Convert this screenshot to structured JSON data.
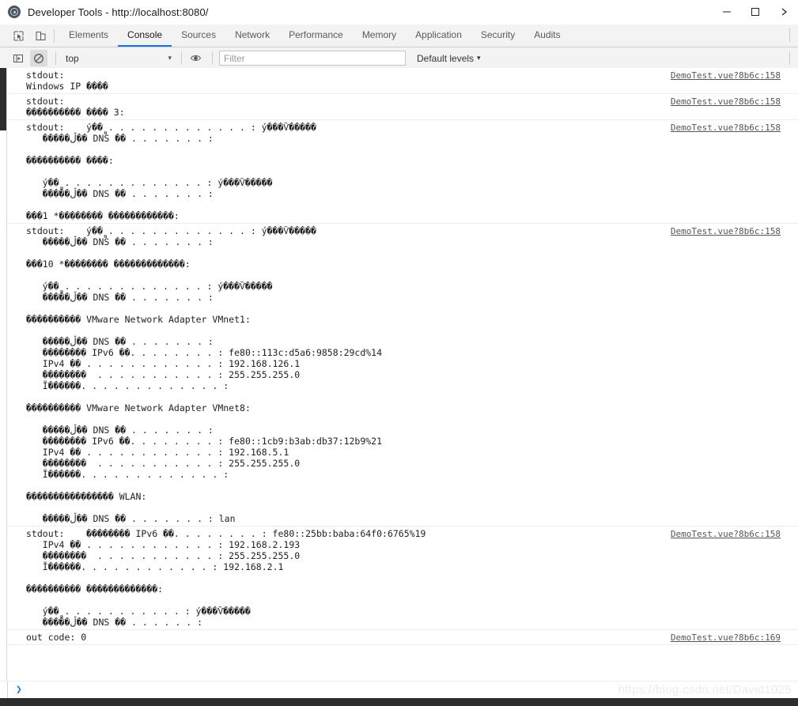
{
  "window": {
    "title": "Developer Tools - http://localhost:8080/",
    "logo_icon": "devtools-logo-icon",
    "controls": {
      "minimize": "minimize-icon",
      "maximize": "maximize-icon",
      "more": "more-chevron-icon"
    }
  },
  "tabstrip": {
    "inspect_icon": "inspect-element-icon",
    "device_icon": "device-toolbar-icon",
    "tabs": [
      {
        "label": "Elements",
        "active": false
      },
      {
        "label": "Console",
        "active": true
      },
      {
        "label": "Sources",
        "active": false
      },
      {
        "label": "Network",
        "active": false
      },
      {
        "label": "Performance",
        "active": false
      },
      {
        "label": "Memory",
        "active": false
      },
      {
        "label": "Application",
        "active": false
      },
      {
        "label": "Security",
        "active": false
      },
      {
        "label": "Audits",
        "active": false
      }
    ]
  },
  "console_toolbar": {
    "sidebar_toggle_icon": "console-sidebar-toggle-icon",
    "clear_icon": "clear-console-icon",
    "context_value": "top",
    "context_caret": "▾",
    "eye_icon": "live-expression-eye-icon",
    "filter_placeholder": "Filter",
    "filter_value": "",
    "levels_label": "Default levels",
    "levels_caret": "▾"
  },
  "console": {
    "messages": [
      {
        "text": "stdout:\nWindows IP ����",
        "source": "DemoTest.vue?8b6c:158"
      },
      {
        "text": "stdout:\n���������� ���� 3:",
        "source": "DemoTest.vue?8b6c:158"
      },
      {
        "text": "stdout:    ý��̻ . . . . . . . . . . . . . : ý���Ѷ�����\n   �����ڵ�� DNS ��׺ . . . . . . . :\n\n���������� ����:\n\n   ý��̻ . . . . . . . . . . . . . : ý���Ѷ�����\n   �����ڵ�� DNS ��׺ . . . . . . . :\n\n���1 *�������� ������������:",
        "source": "DemoTest.vue?8b6c:158"
      },
      {
        "text": "stdout:    ý��̻ . . . . . . . . . . . . . : ý���Ѷ�����\n   �����ڵ�� DNS ��׺ . . . . . . . :\n\n���10 *�������� �������������:\n\n   ý��̻ . . . . . . . . . . . . . : ý���Ѷ�����\n   �����ڵ�� DNS ��׺ . . . . . . . :\n\n���������� VMware Network Adapter VMnet1:\n\n   �����ڵ�� DNS ��׺ . . . . . . . :\n   �������� IPv6 ��. . . . . . . . : fe80::113c:d5a6:9858:29cd%14\n   IPv4 �� . . . . . . . . . . . . : 192.168.126.1\n   ��������  . . . . . . . . . . . : 255.255.255.0\n   Ĭ������. . . . . . . . . . . . . :\n\n���������� VMware Network Adapter VMnet8:\n\n   �����ڵ�� DNS ��׺ . . . . . . . :\n   �������� IPv6 ��. . . . . . . . : fe80::1cb9:b3ab:db37:12b9%21\n   IPv4 �� . . . . . . . . . . . . : 192.168.5.1\n   ��������  . . . . . . . . . . . : 255.255.255.0\n   Ĭ������. . . . . . . . . . . . . :\n\n���������������� WLAN:\n\n   �����ڵ�� DNS ��׺ . . . . . . . : lan",
        "source": "DemoTest.vue?8b6c:158"
      },
      {
        "text": "stdout:    �������� IPv6 ��. . . . . . . . : fe80::25bb:baba:64f0:6765%19\n   IPv4 �� . . . . . . . . . . . . : 192.168.2.193\n   ��������  . . . . . . . . . . . : 255.255.255.0\n   Ĭ������. . . . . . . . . . . . : 192.168.2.1\n\n���������� �������������:\n\n   ý��̻ . . . . . . . . . . . : ý���Ѷ�����\n   �����ڵ�� DNS ��׺ . . . . . . :",
        "source": "DemoTest.vue?8b6c:158"
      },
      {
        "text": "out code: 0",
        "source": "DemoTest.vue?8b6c:169"
      }
    ],
    "prompt_caret": "❯"
  },
  "watermark": "https://blog.csdn.net/David1025",
  "colors": {
    "accent": "#1a73e8",
    "toolbar_bg": "#f3f3f3",
    "border": "#cdcdcd",
    "scrollbar_thumb": "#2d2d2d",
    "link": "#555555",
    "watermark": "#ececec"
  }
}
